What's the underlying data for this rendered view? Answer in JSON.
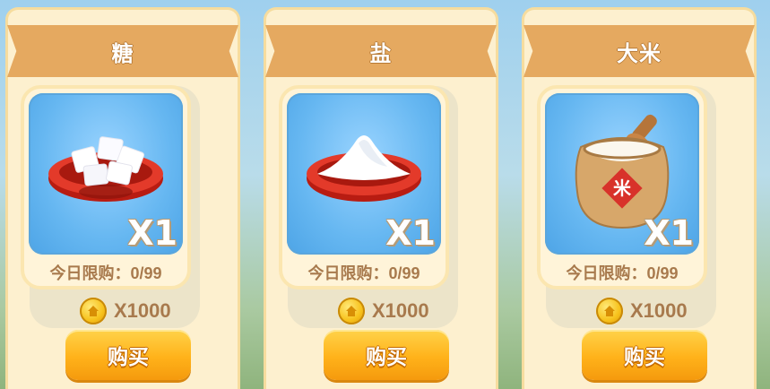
{
  "shop": {
    "items": [
      {
        "name": "糖",
        "quantity": "X1",
        "limit": "今日限购：0/99",
        "price": "X1000",
        "buy_label": "购买",
        "icon": "sugar-cubes-icon"
      },
      {
        "name": "盐",
        "quantity": "X1",
        "limit": "今日限购：0/99",
        "price": "X1000",
        "buy_label": "购买",
        "icon": "salt-pile-icon"
      },
      {
        "name": "大米",
        "quantity": "X1",
        "limit": "今日限购：0/99",
        "price": "X1000",
        "buy_label": "购买",
        "icon": "rice-sack-icon",
        "sack_label": "米"
      }
    ]
  },
  "colors": {
    "ribbon": "#e5a960",
    "card_bg": "#fdf0cf",
    "item_bg": "#66b7f1",
    "buy_button": "#ffb21a",
    "text_brown": "#a87a4d"
  }
}
